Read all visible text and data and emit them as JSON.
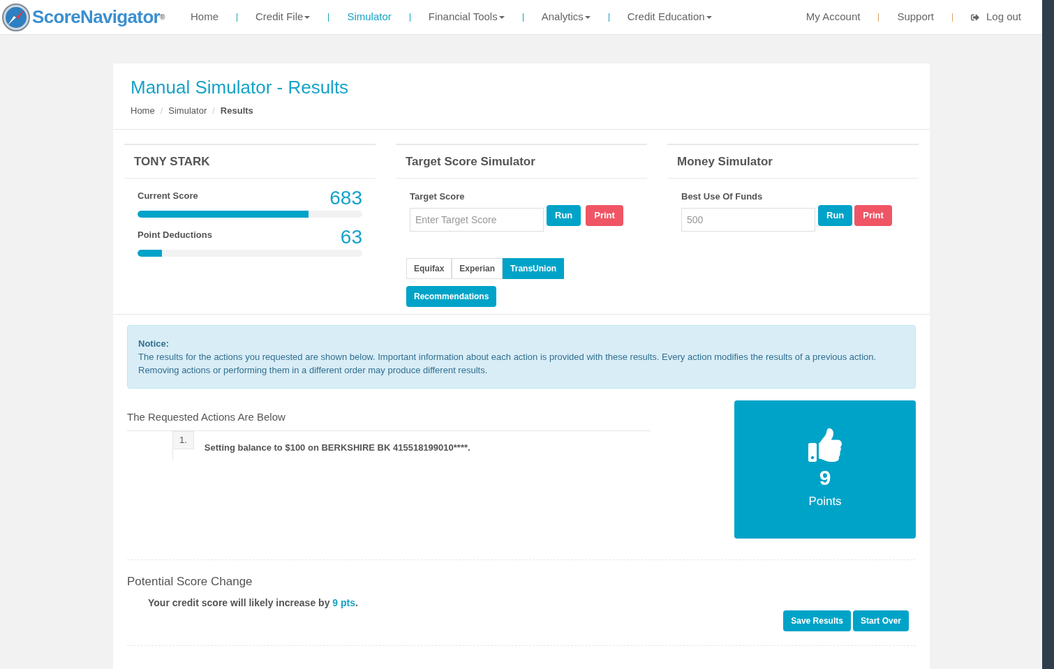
{
  "logo": {
    "text": "ScoreNavigator",
    "mark": "®"
  },
  "nav": [
    {
      "label": "Home",
      "selected": false,
      "dropdown": false
    },
    {
      "label": "Credit File",
      "selected": false,
      "dropdown": true
    },
    {
      "label": "Simulator",
      "selected": true,
      "dropdown": false
    },
    {
      "label": "Financial Tools",
      "selected": false,
      "dropdown": true
    },
    {
      "label": "Analytics",
      "selected": false,
      "dropdown": true
    },
    {
      "label": "Credit Education",
      "selected": false,
      "dropdown": true
    }
  ],
  "account_nav": [
    {
      "label": "My Account",
      "kind": "link"
    },
    {
      "label": "Support",
      "kind": "link"
    },
    {
      "label": "Log out",
      "kind": "logout"
    }
  ],
  "page": {
    "title": "Manual Simulator - Results",
    "breadcrumb": [
      {
        "label": "Home",
        "current": false
      },
      {
        "label": "Simulator",
        "current": false,
        "separator": "/"
      },
      {
        "label": "Results",
        "current": true,
        "separator": "/"
      }
    ]
  },
  "profile": {
    "name": "TONY STARK",
    "meters": [
      {
        "label": "Current Score",
        "value": "683",
        "level": 0.76
      },
      {
        "label": "Point Deductions",
        "value": "63",
        "level": 0.11
      }
    ]
  },
  "target_simulator": {
    "title": "Target Score Simulator",
    "field_label": "Target Score",
    "placeholder": "Enter Target Score",
    "buttons": [
      {
        "label": "Run",
        "kind": "run"
      },
      {
        "label": "Print",
        "kind": "print"
      }
    ],
    "bureaus": [
      {
        "label": "Equifax",
        "selected": false
      },
      {
        "label": "Experian",
        "selected": false
      },
      {
        "label": "TransUnion",
        "selected": true
      }
    ],
    "recommendations": "Recommendations"
  },
  "money_simulator": {
    "title": "Money Simulator",
    "field_label": "Best Use Of Funds",
    "value": "500",
    "buttons": [
      {
        "label": "Run",
        "kind": "run"
      },
      {
        "label": "Print",
        "kind": "print"
      }
    ]
  },
  "notice": {
    "title": "Notice:",
    "text": "The results for the actions you requested are shown below. Important information about each action is provided with these results. Every action modifies the results of a previous action. Removing actions or performing them in a different order may produce different results."
  },
  "actions": {
    "heading": "The Requested Actions Are Below",
    "items": [
      {
        "number": "1.",
        "text": "Setting balance to $100 on BERKSHIRE BK 415518199010****."
      }
    ]
  },
  "result": {
    "value": "9",
    "unit": "Points"
  },
  "score_change": {
    "heading": "Potential Score Change",
    "lead": "Your credit score will likely increase by ",
    "highlight": "9 pts",
    "tail": ".",
    "buttons": [
      "Save Results",
      "Start Over"
    ]
  }
}
